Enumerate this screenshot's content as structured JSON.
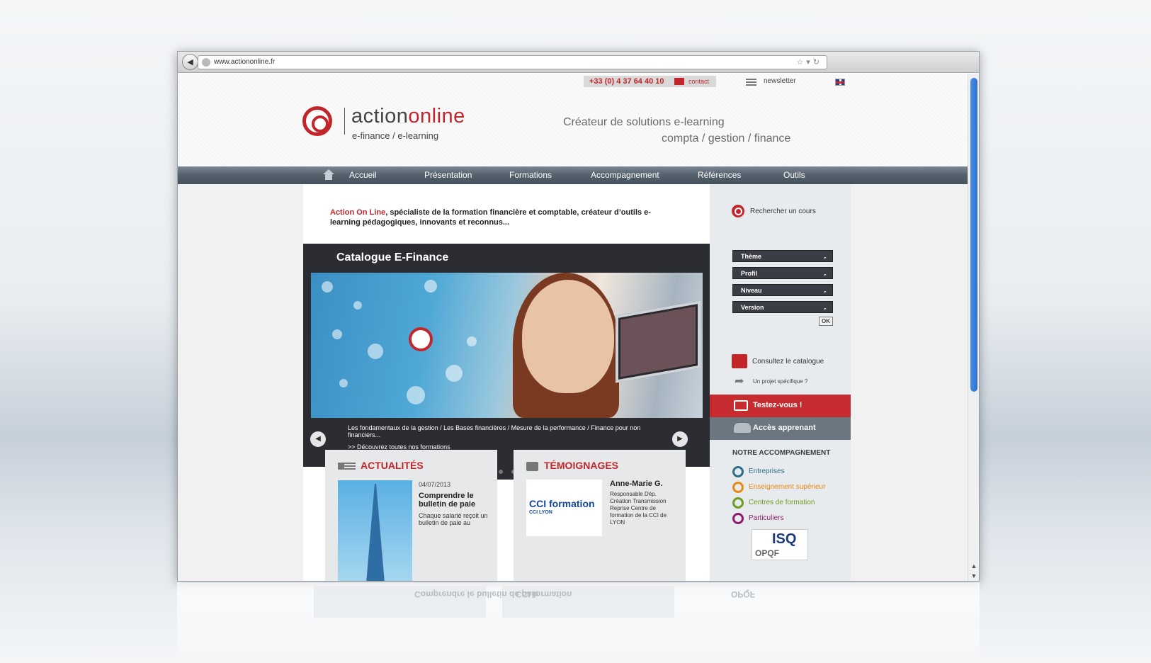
{
  "browser": {
    "url": "www.actiononline.fr"
  },
  "topbar": {
    "phone": "+33 (0) 4 37 64 40 10",
    "contact": "contact",
    "newsletter": "newsletter"
  },
  "brand": {
    "name_part1": "action",
    "name_part2": "online",
    "subtitle": "e-finance / e-learning",
    "tagline_line1": "Créateur de solutions e-learning",
    "tagline_line2": "compta / gestion / finance",
    "brand_color": "#c2262b"
  },
  "nav": {
    "items": [
      "Accueil",
      "Présentation",
      "Formations",
      "Accompagnement",
      "Références",
      "Outils"
    ]
  },
  "intro": {
    "highlight": "Action On Line",
    "text": ", spécialiste de la formation financière et comptable, créateur d’outils e-learning pédagogiques, innovants et reconnus..."
  },
  "carousel": {
    "title": "Catalogue E-Finance",
    "caption": "Les fondamentaux de la gestion / Les Bases financières / Mesure de la performance / Finance pour non financiers...",
    "link": ">> Découvrez toutes nos formations",
    "slides_count": 7,
    "active_slide": 2
  },
  "news": {
    "title": "ACTUALITÉS",
    "date": "04/07/2013",
    "headline": "Comprendre le bulletin de paie",
    "excerpt": "Chaque salarié reçoit un bulletin de paie au"
  },
  "testimonials": {
    "title": "TÉMOIGNAGES",
    "logo_name": "CCI formation",
    "logo_sub": "CCI LYON",
    "person": "Anne-Marie G.",
    "role": "Responsable Dép. Création Transmission Reprise Centre de formation de la CCI de LYON"
  },
  "sidebar": {
    "search": "Rechercher un cours",
    "filters": [
      "Thème",
      "Profil",
      "Niveau",
      "Version"
    ],
    "ok": "OK",
    "catalogue": "Consultez le catalogue",
    "project": "Un projet spécifique ?",
    "test": "Testez-vous !",
    "learner_access": "Accès apprenant",
    "accomp_title": "NOTRE ACCOMPAGNEMENT",
    "accomp_items": [
      {
        "label": "Entreprises",
        "color": "#2b6f86"
      },
      {
        "label": "Enseignement supérieur",
        "color": "#e88a12"
      },
      {
        "label": "Centres de formation",
        "color": "#6a9c1f"
      },
      {
        "label": "Particuliers",
        "color": "#8e1c6c"
      }
    ],
    "cert_logo": "ISQ",
    "cert_sub": "OPQF"
  }
}
